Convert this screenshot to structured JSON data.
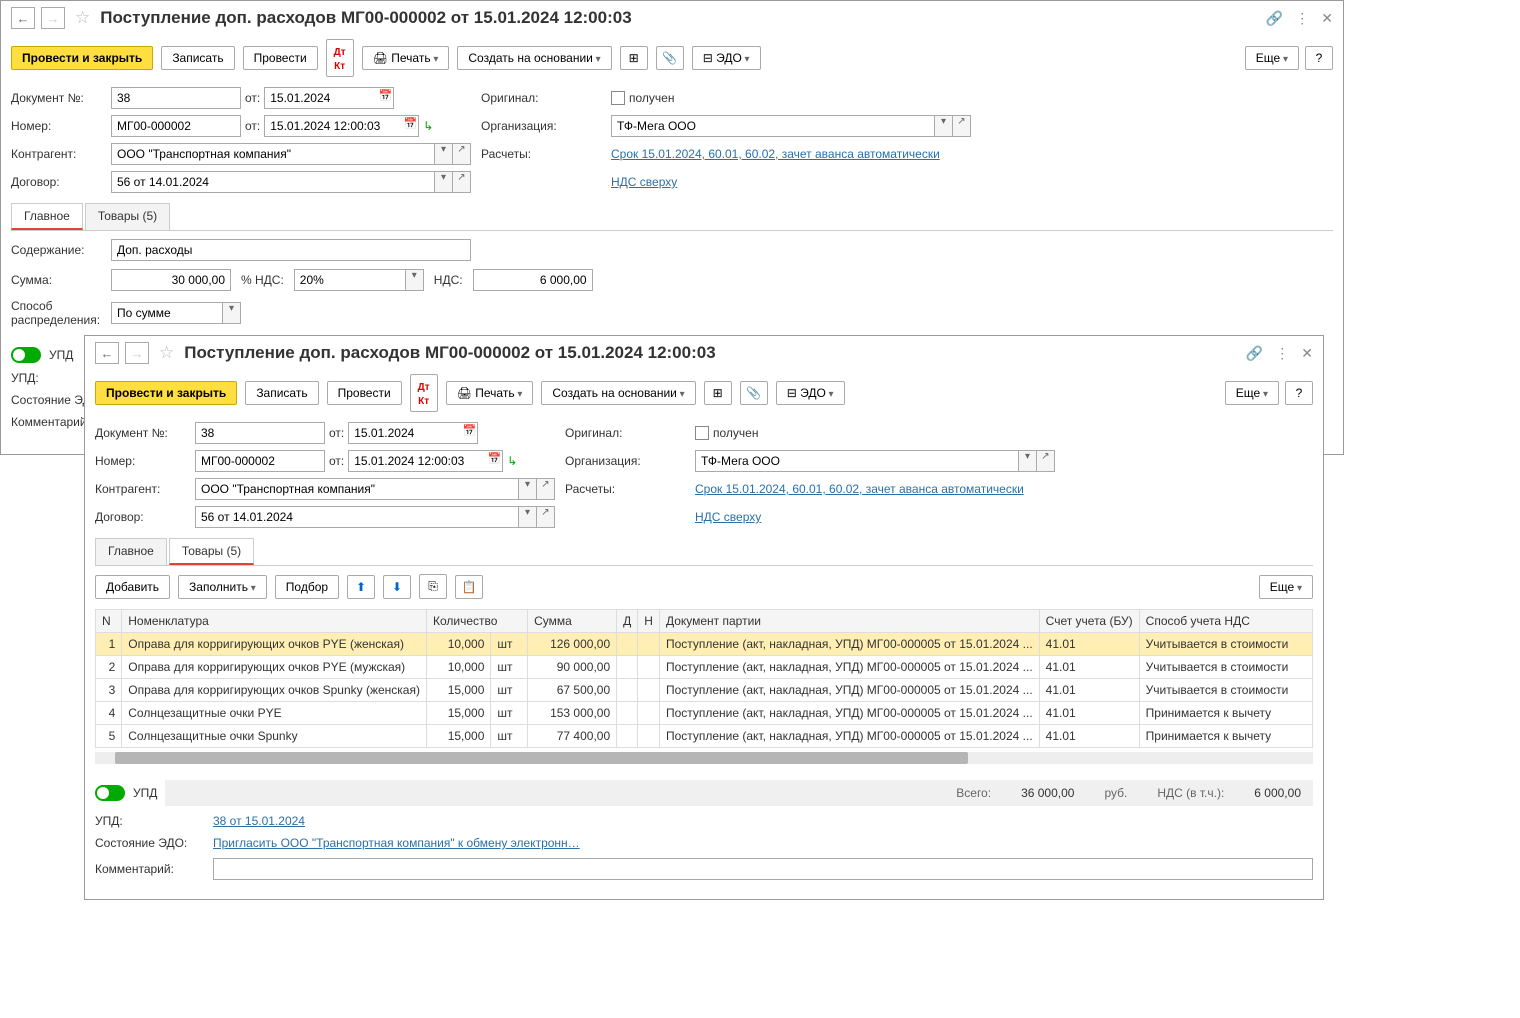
{
  "title": "Поступление доп. расходов МГ00-000002 от 15.01.2024 12:00:03",
  "toolbar": {
    "post_close": "Провести и закрыть",
    "save": "Записать",
    "post": "Провести",
    "print": "Печать",
    "create_based": "Создать на основании",
    "edo": "ЭДО",
    "more": "Еще"
  },
  "labels": {
    "doc_no": "Документ №:",
    "ot": "от:",
    "number": "Номер:",
    "counterparty": "Контрагент:",
    "contract": "Договор:",
    "original": "Оригинал:",
    "received": "получен",
    "org": "Организация:",
    "calc": "Расчеты:",
    "content": "Содержание:",
    "sum": "Сумма:",
    "vat_pct": "% НДС:",
    "vat": "НДС:",
    "distribution": "Способ\nраспределения:",
    "upd": "УПД",
    "upd_field": "УПД:",
    "edo_state": "Состояние ЭДО:",
    "comment": "Комментарий:"
  },
  "fields": {
    "doc_no": "38",
    "doc_date": "15.01.2024",
    "number": "МГ00-000002",
    "number_date": "15.01.2024 12:00:03",
    "counterparty": "ООО \"Транспортная компания\"",
    "contract": "56 от 14.01.2024",
    "org": "ТФ-Мега ООО",
    "calc_link": "Срок 15.01.2024, 60.01, 60.02, зачет аванса автоматически",
    "vat_link": "НДС сверху",
    "content": "Доп. расходы",
    "sum": "30 000,00",
    "vat_pct": "20%",
    "vat": "6 000,00",
    "distribution": "По сумме",
    "upd_link": "38 от 15.01.2024",
    "edo_link": "Пригласить ООО \"Транспортная компания\" к обмену электронн…"
  },
  "tabs": {
    "main": "Главное",
    "goods": "Товары (5)"
  },
  "goods_toolbar": {
    "add": "Добавить",
    "fill": "Заполнить",
    "select": "Подбор"
  },
  "table": {
    "headers": {
      "n": "N",
      "nomenclature": "Номенклатура",
      "qty": "Количество",
      "sum": "Сумма",
      "d": "Д",
      "h": "Н",
      "batch_doc": "Документ партии",
      "account": "Счет учета (БУ)",
      "vat_method": "Способ учета НДС"
    },
    "rows": [
      {
        "n": "1",
        "name": "Оправа для корригирующих очков PYE (женская)",
        "qty": "10,000",
        "unit": "шт",
        "sum": "126 000,00",
        "doc": "Поступление (акт, накладная, УПД) МГ00-000005 от 15.01.2024 ...",
        "acc": "41.01",
        "vat": "Учитывается в стоимости"
      },
      {
        "n": "2",
        "name": "Оправа для корригирующих очков PYE (мужская)",
        "qty": "10,000",
        "unit": "шт",
        "sum": "90 000,00",
        "doc": "Поступление (акт, накладная, УПД) МГ00-000005 от 15.01.2024 ...",
        "acc": "41.01",
        "vat": "Учитывается в стоимости"
      },
      {
        "n": "3",
        "name": "Оправа для корригирующих очков Spunky (женская)",
        "qty": "15,000",
        "unit": "шт",
        "sum": "67 500,00",
        "doc": "Поступление (акт, накладная, УПД) МГ00-000005 от 15.01.2024 ...",
        "acc": "41.01",
        "vat": "Учитывается в стоимости"
      },
      {
        "n": "4",
        "name": "Солнцезащитные очки PYE",
        "qty": "15,000",
        "unit": "шт",
        "sum": "153 000,00",
        "doc": "Поступление (акт, накладная, УПД) МГ00-000005 от 15.01.2024 ...",
        "acc": "41.01",
        "vat": "Принимается к вычету"
      },
      {
        "n": "5",
        "name": "Солнцезащитные очки Spunky",
        "qty": "15,000",
        "unit": "шт",
        "sum": "77 400,00",
        "doc": "Поступление (акт, накладная, УПД) МГ00-000005 от 15.01.2024 ...",
        "acc": "41.01",
        "vat": "Принимается к вычету"
      }
    ]
  },
  "summary": {
    "total_lbl": "Всего:",
    "total": "36 000,00",
    "rub": "руб.",
    "vat_lbl": "НДС (в т.ч.):",
    "vat": "6 000,00"
  }
}
